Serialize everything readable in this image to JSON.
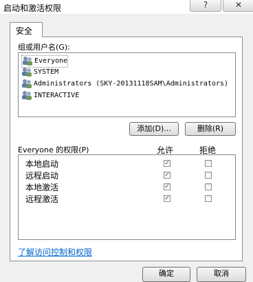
{
  "window": {
    "title": "启动和激活权限",
    "help_label": "?",
    "close_label": "✕"
  },
  "tab": {
    "label": "安全"
  },
  "users": {
    "label": "组或用户名(G):",
    "items": [
      {
        "name": "Everyone",
        "icon": "user-group-icon"
      },
      {
        "name": "SYSTEM",
        "icon": "user-group-icon"
      },
      {
        "name": "Administrators (SKY-20131118SAM\\Administrators)",
        "icon": "user-group-icon"
      },
      {
        "name": "INTERACTIVE",
        "icon": "user-group-icon"
      }
    ],
    "add_label": "添加(D)...",
    "remove_label": "删除(R)"
  },
  "permissions": {
    "label": "Everyone 的权限(P)",
    "allow_header": "允许",
    "deny_header": "拒绝",
    "rows": [
      {
        "name": "本地启动",
        "allow": true,
        "deny": false
      },
      {
        "name": "远程启动",
        "allow": true,
        "deny": false
      },
      {
        "name": "本地激活",
        "allow": true,
        "deny": false
      },
      {
        "name": "远程激活",
        "allow": true,
        "deny": false
      }
    ]
  },
  "link": {
    "label": "了解访问控制和权限"
  },
  "footer": {
    "ok_label": "确定",
    "cancel_label": "取消"
  }
}
